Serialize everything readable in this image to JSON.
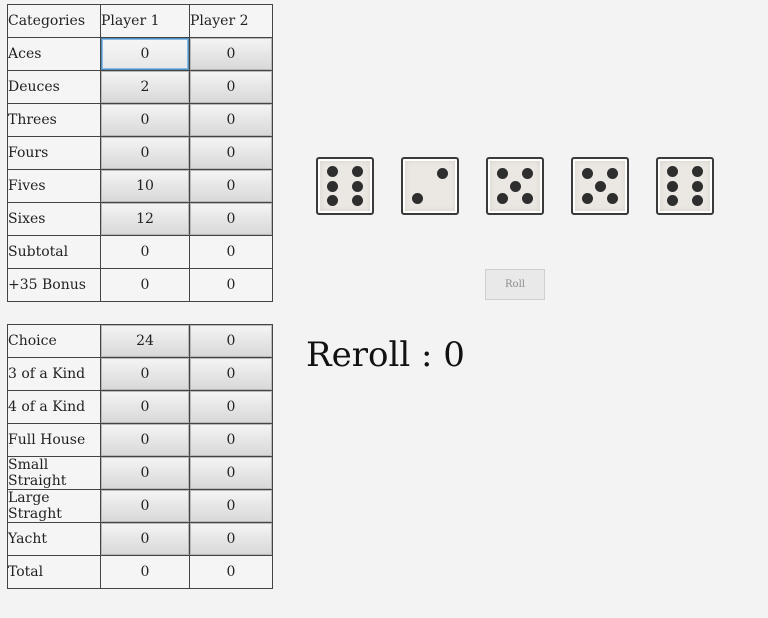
{
  "header": {
    "categories": "Categories",
    "player1": "Player 1",
    "player2": "Player 2"
  },
  "upper_rows": [
    {
      "label": "Aces",
      "p1": "0",
      "p2": "0",
      "clickable": true
    },
    {
      "label": "Deuces",
      "p1": "2",
      "p2": "0",
      "clickable": true
    },
    {
      "label": "Threes",
      "p1": "0",
      "p2": "0",
      "clickable": true
    },
    {
      "label": "Fours",
      "p1": "0",
      "p2": "0",
      "clickable": true
    },
    {
      "label": "Fives",
      "p1": "10",
      "p2": "0",
      "clickable": true
    },
    {
      "label": "Sixes",
      "p1": "12",
      "p2": "0",
      "clickable": true
    },
    {
      "label": "Subtotal",
      "p1": "0",
      "p2": "0",
      "clickable": false
    },
    {
      "label": "+35 Bonus",
      "p1": "0",
      "p2": "0",
      "clickable": false
    }
  ],
  "lower_rows": [
    {
      "label": "Choice",
      "p1": "24",
      "p2": "0",
      "clickable": true
    },
    {
      "label": "3 of a Kind",
      "p1": "0",
      "p2": "0",
      "clickable": true
    },
    {
      "label": "4 of a Kind",
      "p1": "0",
      "p2": "0",
      "clickable": true
    },
    {
      "label": "Full House",
      "p1": "0",
      "p2": "0",
      "clickable": true
    },
    {
      "label": "Small Straight",
      "p1": "0",
      "p2": "0",
      "clickable": true
    },
    {
      "label": "Large Straght",
      "p1": "0",
      "p2": "0",
      "clickable": true
    },
    {
      "label": "Yacht",
      "p1": "0",
      "p2": "0",
      "clickable": true
    },
    {
      "label": "Total",
      "p1": "0",
      "p2": "0",
      "clickable": false
    }
  ],
  "dice": [
    6,
    2,
    5,
    5,
    6
  ],
  "roll_label": "Roll",
  "reroll_label": "Reroll : 0"
}
